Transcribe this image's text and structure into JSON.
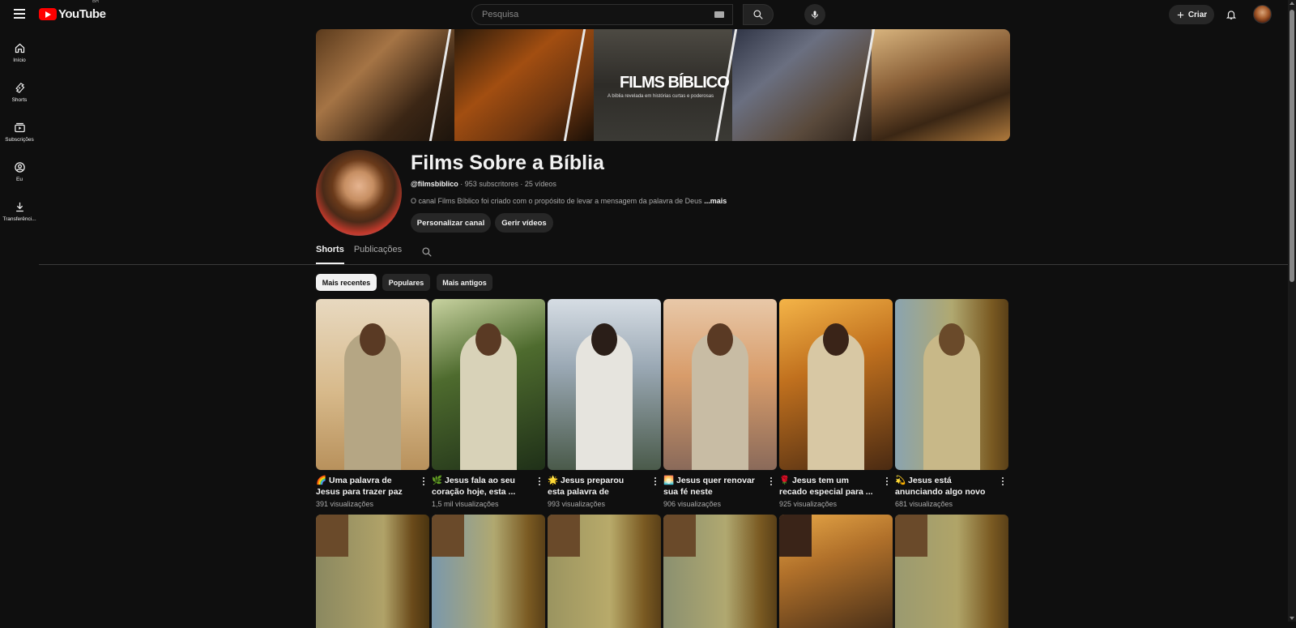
{
  "header": {
    "logo_text": "YouTube",
    "country_code": "BR",
    "search_placeholder": "Pesquisa",
    "create_label": "Criar"
  },
  "sidebar": {
    "items": [
      {
        "label": "Início",
        "icon": "home-icon"
      },
      {
        "label": "Shorts",
        "icon": "shorts-icon"
      },
      {
        "label": "Subscrições",
        "icon": "subscriptions-icon"
      },
      {
        "label": "Eu",
        "icon": "account-icon"
      },
      {
        "label": "Transferênci...",
        "icon": "download-icon"
      }
    ]
  },
  "banner": {
    "title": "FILMS BÍBLICO",
    "subtitle": "A bíblia revelada em histórias curtas e poderosas"
  },
  "channel": {
    "name": "Films Sobre a Bíblia",
    "handle": "@filmsbiblico",
    "subscribers": "953 subscritores",
    "videos": "25 vídeos",
    "description": "O canal Films Bíblico foi criado com o propósito de levar a mensagem da palavra de Deus",
    "more_label": "...mais",
    "customize_label": "Personalizar canal",
    "manage_label": "Gerir vídeos"
  },
  "tabs": [
    {
      "label": "Shorts",
      "active": true
    },
    {
      "label": "Publicações",
      "active": false
    }
  ],
  "chips": [
    {
      "label": "Mais recentes",
      "active": true
    },
    {
      "label": "Populares",
      "active": false
    },
    {
      "label": "Mais antigos",
      "active": false
    }
  ],
  "shorts": [
    {
      "title": "🌈 Uma palavra de Jesus para trazer paz ...",
      "views": "391 visualizações"
    },
    {
      "title": "🌿 Jesus fala ao seu coração hoje, esta ...",
      "views": "1,5 mil visualizações"
    },
    {
      "title": "🌟 Jesus preparou esta palavra de conforto ...",
      "views": "993 visualizações"
    },
    {
      "title": "🌅 Jesus quer renovar sua fé neste momento...",
      "views": "906 visualizações"
    },
    {
      "title": "🌹 Jesus tem um recado especial para ...",
      "views": "925 visualizações"
    },
    {
      "title": "💫 Jesus está anunciando algo novo ...",
      "views": "681 visualizações"
    }
  ],
  "colors": {
    "background": "#0f0f0f",
    "youtube_red": "#ff0000",
    "chip_active": "#f1f1f1",
    "chip_bg": "#272727"
  }
}
